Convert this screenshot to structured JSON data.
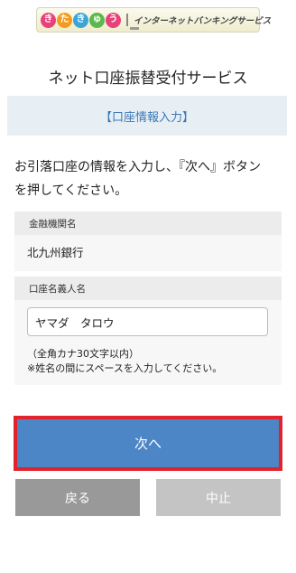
{
  "banner": {
    "logo_chars": [
      "き",
      "た",
      "き",
      "ゅ",
      "う"
    ],
    "logo_colors": [
      "#e8417a",
      "#f39b1f",
      "#3ba5d8",
      "#5bb84d",
      "#e8417a"
    ],
    "tagline": "インターネットバンキングサービス"
  },
  "page_title": "ネット口座振替受付サービス",
  "section_title": "【口座情報入力】",
  "intro_line1": "お引落口座の情報を入力し、『次へ』ボタン",
  "intro_line2": "を押してください。",
  "bank": {
    "label": "金融機関名",
    "value": "北九州銀行"
  },
  "account_name": {
    "label": "口座名義人名",
    "value": "ヤマダ　タロウ",
    "hint_line1": "（全角カナ30文字以内）",
    "hint_line2": "※姓名の間にスペースを入力してください。"
  },
  "buttons": {
    "next": "次へ",
    "back": "戻る",
    "cancel": "中止"
  },
  "colors": {
    "next_button": "#4c86c6",
    "highlight_border": "#e0232d",
    "back_button": "#999999",
    "cancel_button": "#c4c4c4"
  }
}
